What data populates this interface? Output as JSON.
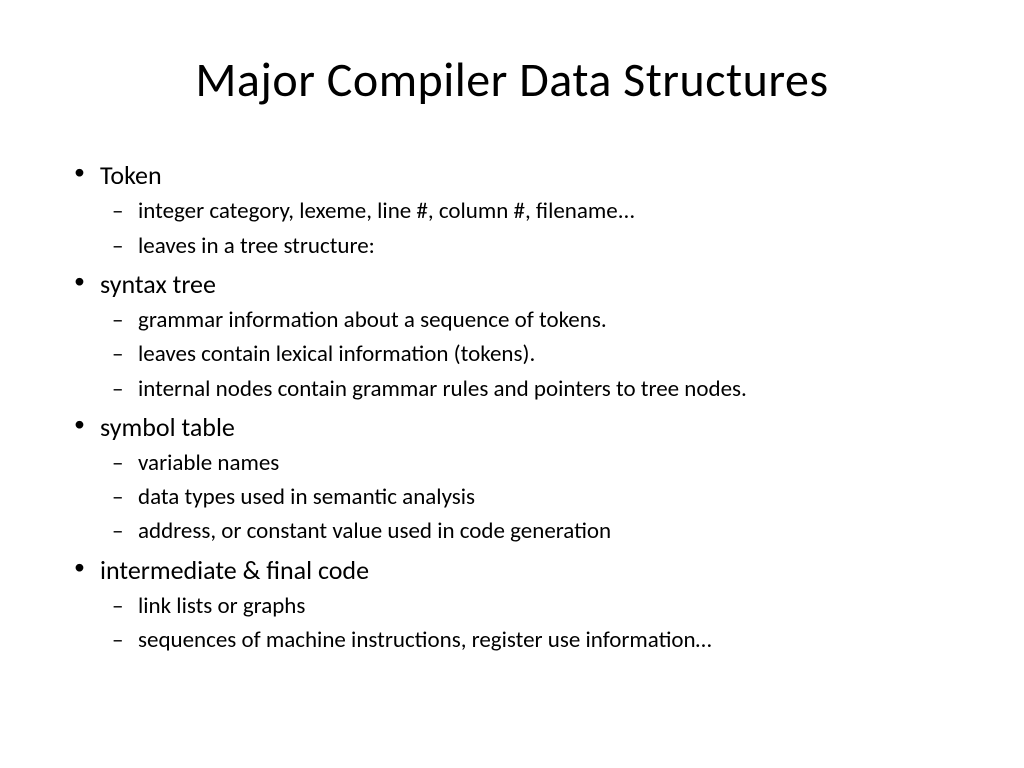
{
  "title": "Major Compiler Data Structures",
  "bullets": [
    {
      "label": "Token",
      "children": [
        "integer category, lexeme, line #, column #, filename...",
        "leaves in a tree structure:"
      ]
    },
    {
      "label": "syntax tree",
      "children": [
        "grammar information about a sequence of tokens.",
        "leaves contain lexical information (tokens).",
        "internal nodes contain grammar rules and pointers to tree nodes."
      ]
    },
    {
      "label": "symbol table",
      "children": [
        "variable names",
        "data types used in semantic analysis",
        "address, or constant value used in code generation"
      ]
    },
    {
      "label": "intermediate & final code",
      "children": [
        "link lists or graphs",
        "sequences of machine instructions, register use information…"
      ]
    }
  ]
}
